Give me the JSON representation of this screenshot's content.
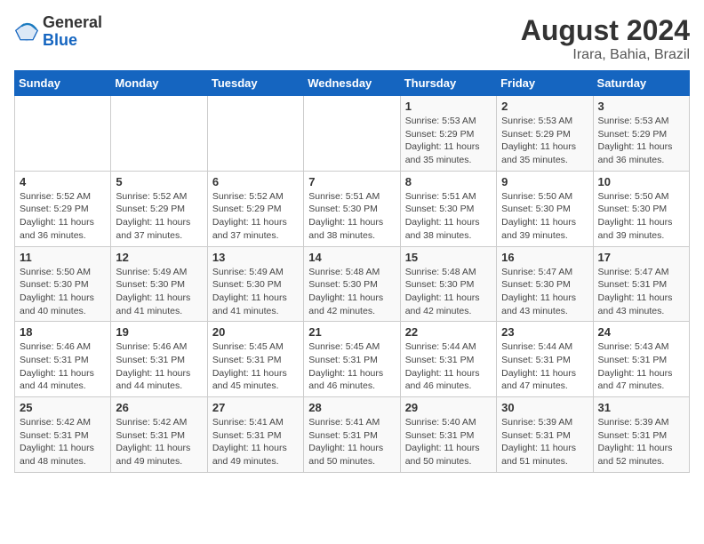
{
  "header": {
    "logo_general": "General",
    "logo_blue": "Blue",
    "month_year": "August 2024",
    "location": "Irara, Bahia, Brazil"
  },
  "days_of_week": [
    "Sunday",
    "Monday",
    "Tuesday",
    "Wednesday",
    "Thursday",
    "Friday",
    "Saturday"
  ],
  "weeks": [
    [
      {
        "day": "",
        "info": ""
      },
      {
        "day": "",
        "info": ""
      },
      {
        "day": "",
        "info": ""
      },
      {
        "day": "",
        "info": ""
      },
      {
        "day": "1",
        "info": "Sunrise: 5:53 AM\nSunset: 5:29 PM\nDaylight: 11 hours and 35 minutes."
      },
      {
        "day": "2",
        "info": "Sunrise: 5:53 AM\nSunset: 5:29 PM\nDaylight: 11 hours and 35 minutes."
      },
      {
        "day": "3",
        "info": "Sunrise: 5:53 AM\nSunset: 5:29 PM\nDaylight: 11 hours and 36 minutes."
      }
    ],
    [
      {
        "day": "4",
        "info": "Sunrise: 5:52 AM\nSunset: 5:29 PM\nDaylight: 11 hours and 36 minutes."
      },
      {
        "day": "5",
        "info": "Sunrise: 5:52 AM\nSunset: 5:29 PM\nDaylight: 11 hours and 37 minutes."
      },
      {
        "day": "6",
        "info": "Sunrise: 5:52 AM\nSunset: 5:29 PM\nDaylight: 11 hours and 37 minutes."
      },
      {
        "day": "7",
        "info": "Sunrise: 5:51 AM\nSunset: 5:30 PM\nDaylight: 11 hours and 38 minutes."
      },
      {
        "day": "8",
        "info": "Sunrise: 5:51 AM\nSunset: 5:30 PM\nDaylight: 11 hours and 38 minutes."
      },
      {
        "day": "9",
        "info": "Sunrise: 5:50 AM\nSunset: 5:30 PM\nDaylight: 11 hours and 39 minutes."
      },
      {
        "day": "10",
        "info": "Sunrise: 5:50 AM\nSunset: 5:30 PM\nDaylight: 11 hours and 39 minutes."
      }
    ],
    [
      {
        "day": "11",
        "info": "Sunrise: 5:50 AM\nSunset: 5:30 PM\nDaylight: 11 hours and 40 minutes."
      },
      {
        "day": "12",
        "info": "Sunrise: 5:49 AM\nSunset: 5:30 PM\nDaylight: 11 hours and 41 minutes."
      },
      {
        "day": "13",
        "info": "Sunrise: 5:49 AM\nSunset: 5:30 PM\nDaylight: 11 hours and 41 minutes."
      },
      {
        "day": "14",
        "info": "Sunrise: 5:48 AM\nSunset: 5:30 PM\nDaylight: 11 hours and 42 minutes."
      },
      {
        "day": "15",
        "info": "Sunrise: 5:48 AM\nSunset: 5:30 PM\nDaylight: 11 hours and 42 minutes."
      },
      {
        "day": "16",
        "info": "Sunrise: 5:47 AM\nSunset: 5:30 PM\nDaylight: 11 hours and 43 minutes."
      },
      {
        "day": "17",
        "info": "Sunrise: 5:47 AM\nSunset: 5:31 PM\nDaylight: 11 hours and 43 minutes."
      }
    ],
    [
      {
        "day": "18",
        "info": "Sunrise: 5:46 AM\nSunset: 5:31 PM\nDaylight: 11 hours and 44 minutes."
      },
      {
        "day": "19",
        "info": "Sunrise: 5:46 AM\nSunset: 5:31 PM\nDaylight: 11 hours and 44 minutes."
      },
      {
        "day": "20",
        "info": "Sunrise: 5:45 AM\nSunset: 5:31 PM\nDaylight: 11 hours and 45 minutes."
      },
      {
        "day": "21",
        "info": "Sunrise: 5:45 AM\nSunset: 5:31 PM\nDaylight: 11 hours and 46 minutes."
      },
      {
        "day": "22",
        "info": "Sunrise: 5:44 AM\nSunset: 5:31 PM\nDaylight: 11 hours and 46 minutes."
      },
      {
        "day": "23",
        "info": "Sunrise: 5:44 AM\nSunset: 5:31 PM\nDaylight: 11 hours and 47 minutes."
      },
      {
        "day": "24",
        "info": "Sunrise: 5:43 AM\nSunset: 5:31 PM\nDaylight: 11 hours and 47 minutes."
      }
    ],
    [
      {
        "day": "25",
        "info": "Sunrise: 5:42 AM\nSunset: 5:31 PM\nDaylight: 11 hours and 48 minutes."
      },
      {
        "day": "26",
        "info": "Sunrise: 5:42 AM\nSunset: 5:31 PM\nDaylight: 11 hours and 49 minutes."
      },
      {
        "day": "27",
        "info": "Sunrise: 5:41 AM\nSunset: 5:31 PM\nDaylight: 11 hours and 49 minutes."
      },
      {
        "day": "28",
        "info": "Sunrise: 5:41 AM\nSunset: 5:31 PM\nDaylight: 11 hours and 50 minutes."
      },
      {
        "day": "29",
        "info": "Sunrise: 5:40 AM\nSunset: 5:31 PM\nDaylight: 11 hours and 50 minutes."
      },
      {
        "day": "30",
        "info": "Sunrise: 5:39 AM\nSunset: 5:31 PM\nDaylight: 11 hours and 51 minutes."
      },
      {
        "day": "31",
        "info": "Sunrise: 5:39 AM\nSunset: 5:31 PM\nDaylight: 11 hours and 52 minutes."
      }
    ]
  ]
}
